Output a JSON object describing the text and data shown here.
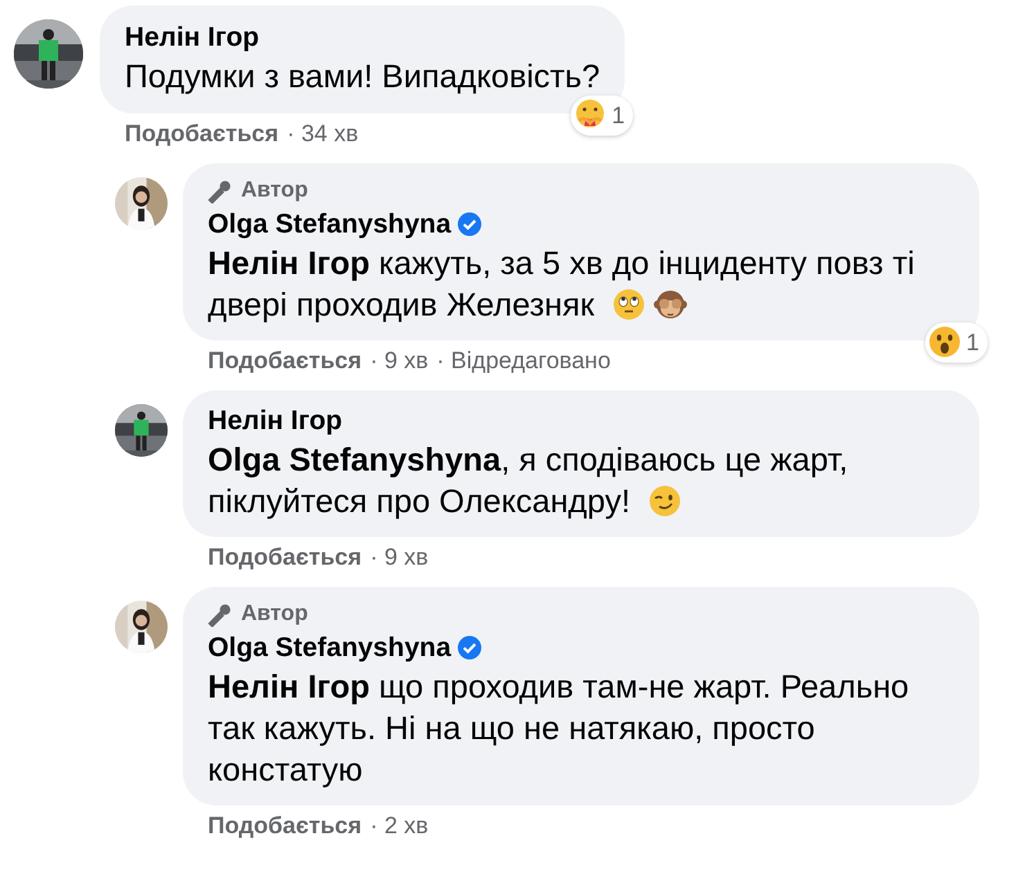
{
  "comments": [
    {
      "author": "Нелін Ігор",
      "reply": false,
      "verified": false,
      "text": "Подумки з вами! Випадковість?",
      "reaction": {
        "kind": "care",
        "count": "1"
      },
      "like": "Подобається",
      "time": "· 34 хв"
    },
    {
      "author": "Olga Stefanyshyna",
      "reply": true,
      "author_badge": "Автор",
      "verified": true,
      "text": "**Нелін Ігор** кажуть, за 5 хв до інциденту повз ті двері проходив Железняк",
      "emoji": [
        {
          "kind": "eyeroll"
        },
        {
          "kind": "see-no-evil"
        }
      ],
      "reaction": {
        "kind": "wow",
        "count": "1"
      },
      "like": "Подобається",
      "time": "· 9 хв",
      "edited": "· Відредаговано"
    },
    {
      "author": "Нелін Ігор",
      "reply": true,
      "verified": false,
      "text": "**Olga Stefanyshyna**, я сподіваюсь це жарт, піклуйтеся про Олександру!",
      "emoji": [
        {
          "kind": "wink"
        }
      ],
      "like": "Подобається",
      "time": "· 9 хв"
    },
    {
      "author": "Olga Stefanyshyna",
      "reply": true,
      "author_badge": "Автор",
      "verified": true,
      "text": "**Нелін Ігор** що проходив там-не жарт. Реально так кажуть. Ні на що не натякаю, просто констатую",
      "like": "Подобається",
      "time": "· 2 хв"
    }
  ]
}
